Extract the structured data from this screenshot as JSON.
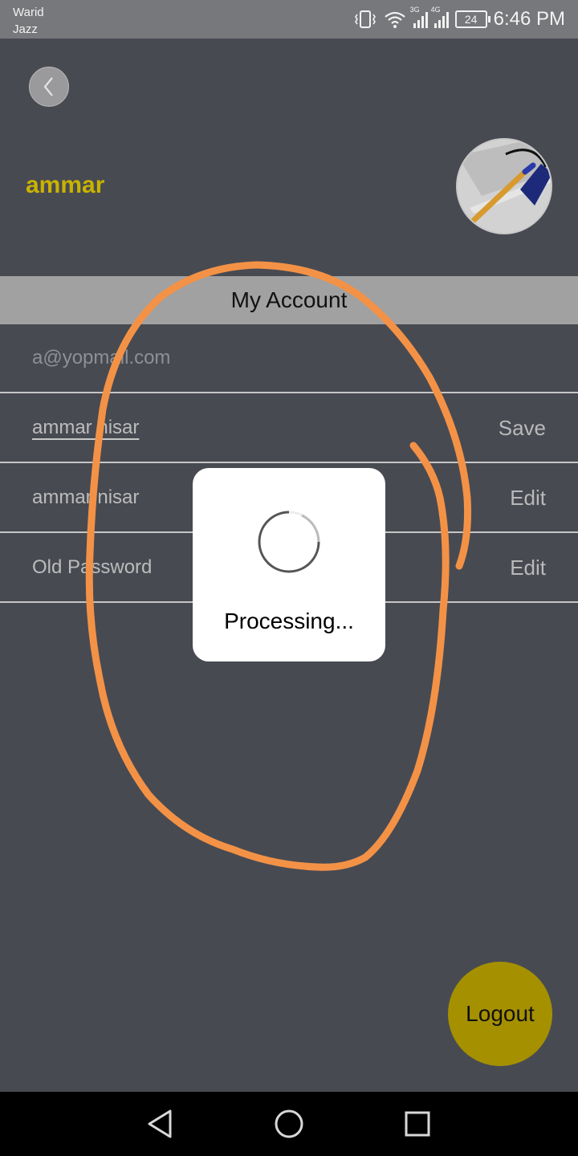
{
  "status_bar": {
    "carrier_line1": "Warid",
    "carrier_line2": "Jazz",
    "network_3g": "3G",
    "network_4g": "4G",
    "battery": "24",
    "time": "6:46 PM"
  },
  "header": {
    "username": "ammar"
  },
  "account": {
    "section_title": "My Account",
    "email_placeholder": "a@yopmail.com",
    "name_input_value": "ammar nisar",
    "save_label": "Save",
    "name_display": "ammar nisar",
    "edit_label_name": "Edit",
    "password_placeholder": "Old Password",
    "edit_label_password": "Edit"
  },
  "dialog": {
    "message": "Processing..."
  },
  "logout_label": "Logout",
  "colors": {
    "background": "#484a52",
    "username": "#c9b300",
    "logout": "#a59000",
    "annotation": "#f39246"
  },
  "icons": {
    "back": "chevron-left-icon",
    "nav_back": "triangle-back-icon",
    "nav_home": "circle-home-icon",
    "nav_recents": "square-recents-icon"
  }
}
